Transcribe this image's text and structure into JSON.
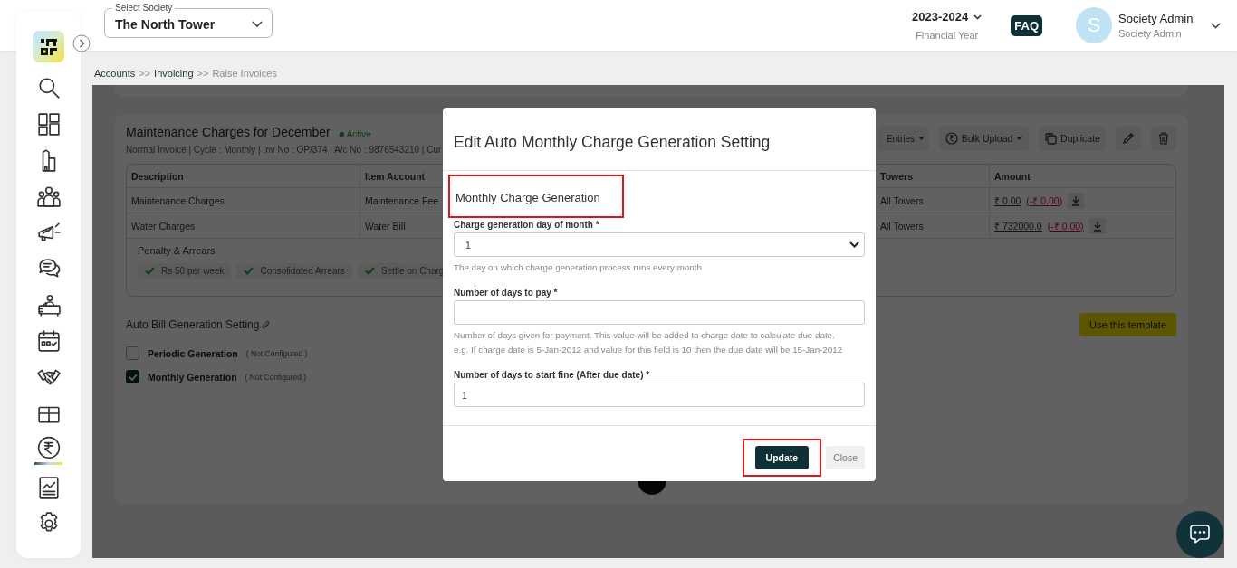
{
  "header": {
    "society_select": {
      "label": "Select Society",
      "value": "The North Tower"
    },
    "financial_year": {
      "value": "2023-2024",
      "caption": "Financial Year"
    },
    "faq": "FAQ",
    "user": {
      "avatar": "S",
      "name": "Society Admin",
      "role": "Society Admin"
    }
  },
  "sidebar": {
    "items": [
      {
        "kind": "search",
        "selected": false
      },
      {
        "kind": "dashboard",
        "selected": false
      },
      {
        "kind": "building",
        "selected": false
      },
      {
        "kind": "people",
        "selected": false
      },
      {
        "kind": "megaphone",
        "selected": false
      },
      {
        "kind": "chat",
        "selected": false
      },
      {
        "kind": "desk",
        "selected": false
      },
      {
        "kind": "calendar",
        "selected": false
      },
      {
        "kind": "handshake",
        "selected": false
      },
      {
        "kind": "box",
        "selected": false
      },
      {
        "kind": "rupee",
        "selected": true
      },
      {
        "kind": "report",
        "selected": false
      },
      {
        "kind": "settings",
        "selected": false
      }
    ]
  },
  "breadcrumb": {
    "separator": ">>",
    "items": [
      {
        "label": "Accounts",
        "current": false
      },
      {
        "label": "Invoicing",
        "current": false
      },
      {
        "label": "Raise Invoices",
        "current": true
      }
    ]
  },
  "template_card": {
    "title": "Maintenance Charges for December",
    "status": "Active",
    "meta": "Normal Invoice | Cycle : Monthly | Inv No : OP/374 | A/c No : 9876543210 | Cur",
    "toolbar": [
      {
        "kind": "menu",
        "label": "Entries"
      },
      {
        "kind": "upload",
        "label": "Bulk Upload"
      },
      {
        "kind": "duplicate",
        "label": "Duplicate"
      },
      {
        "kind": "edit"
      },
      {
        "kind": "delete"
      }
    ],
    "table": {
      "columns": [
        "Description",
        "Item Account",
        "Towers",
        "Amount"
      ],
      "rows": [
        {
          "description": "Maintenance Charges",
          "item_account": "Maintenance Fee",
          "towers": "All Towers",
          "amount": "₹ 0.00",
          "adjustment": "(-₹ 0.00)"
        },
        {
          "description": "Water Charges",
          "item_account": "Water Bill",
          "towers": "All Towers",
          "amount": "₹ 732000.0",
          "adjustment": "(-₹ 0.00)"
        }
      ]
    },
    "penalty": {
      "title": "Penalty & Arrears",
      "tags": [
        "Rs 50 per week",
        "Consolidated Arrears",
        "Settle on Charg"
      ]
    },
    "auto_bill": {
      "title": "Auto Bill Generation Setting",
      "template_button": "Use this template",
      "options": [
        {
          "label": "Periodic Generation",
          "status": "( Not Configured )",
          "checked": false
        },
        {
          "label": "Monthly Generation",
          "status": "( Not Configured )",
          "checked": true
        }
      ]
    }
  },
  "modal": {
    "title": "Edit Auto Monthly Charge Generation Setting",
    "section": {
      "title": "Monthly Charge Generation",
      "highlighted": true
    },
    "fields": [
      {
        "kind": "select",
        "label": "Charge generation day of month *",
        "value": "1",
        "help": [
          "The day on which charge generation process runs every month"
        ]
      },
      {
        "kind": "input",
        "label": "Number of days to pay *",
        "help": [
          "Number of days given for payment. This value will be added to charge date to calculate due date.",
          "e.g. If charge date is 5-Jan-2012 and value for this field is 10 then the due date will be 15-Jan-2012"
        ]
      },
      {
        "kind": "input",
        "label": "Number of days to start fine (After due date) *",
        "value": "1"
      }
    ],
    "buttons": [
      {
        "kind": "primary",
        "label": "Update",
        "highlighted": true
      },
      {
        "kind": "secondary",
        "label": "Close",
        "highlighted": false
      }
    ]
  }
}
